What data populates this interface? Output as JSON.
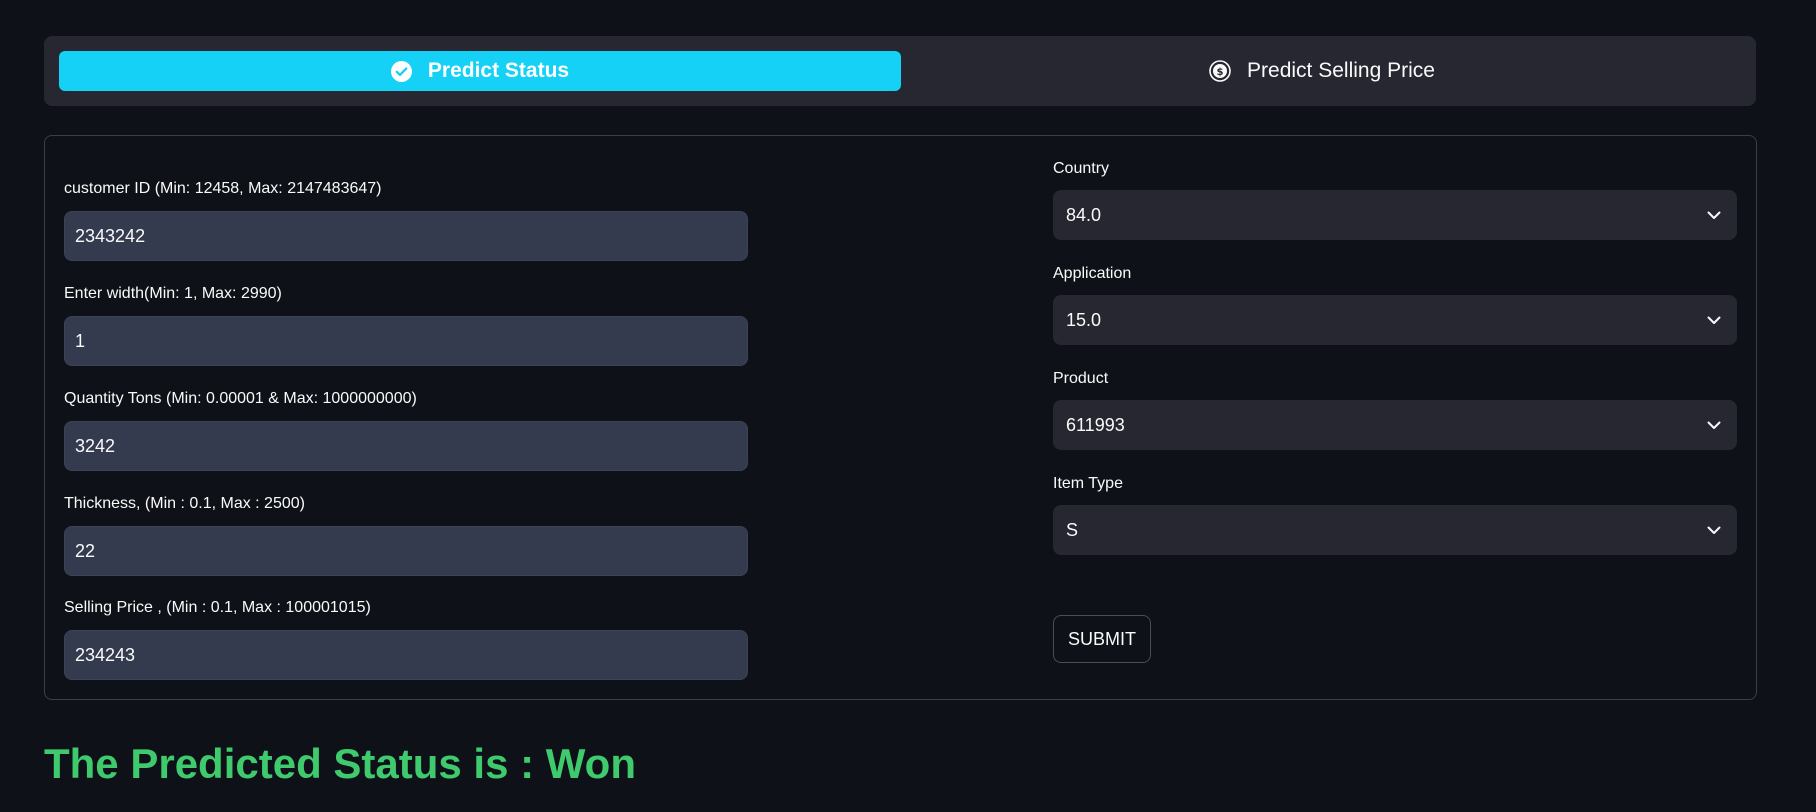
{
  "tabs": [
    {
      "label": "Predict Status",
      "icon": "check-circle-icon",
      "active": true
    },
    {
      "label": "Predict Selling Price",
      "icon": "dollar-circle-icon",
      "active": false
    }
  ],
  "left_fields": [
    {
      "label": "customer ID (Min: 12458, Max: 2147483647)",
      "value": "2343242"
    },
    {
      "label": "Enter width(Min: 1, Max: 2990)",
      "value": "1"
    },
    {
      "label": "Quantity Tons (Min: 0.00001 & Max: 1000000000)",
      "value": "3242"
    },
    {
      "label": "Thickness, (Min : 0.1, Max : 2500)",
      "value": "22"
    },
    {
      "label": "Selling Price , (Min : 0.1, Max : 100001015)",
      "value": "234243"
    }
  ],
  "right_selects": [
    {
      "label": "Country",
      "value": "84.0"
    },
    {
      "label": "Application",
      "value": "15.0"
    },
    {
      "label": "Product",
      "value": "611993"
    },
    {
      "label": "Item Type",
      "value": "S"
    }
  ],
  "submit_label": "SUBMIT",
  "result_text": "The Predicted Status is : Won",
  "colors": {
    "background": "#0e1117",
    "active_tab": "#14d1f5",
    "result": "#3fca6e",
    "input_bg": "#343b4e",
    "select_bg": "#262730"
  }
}
